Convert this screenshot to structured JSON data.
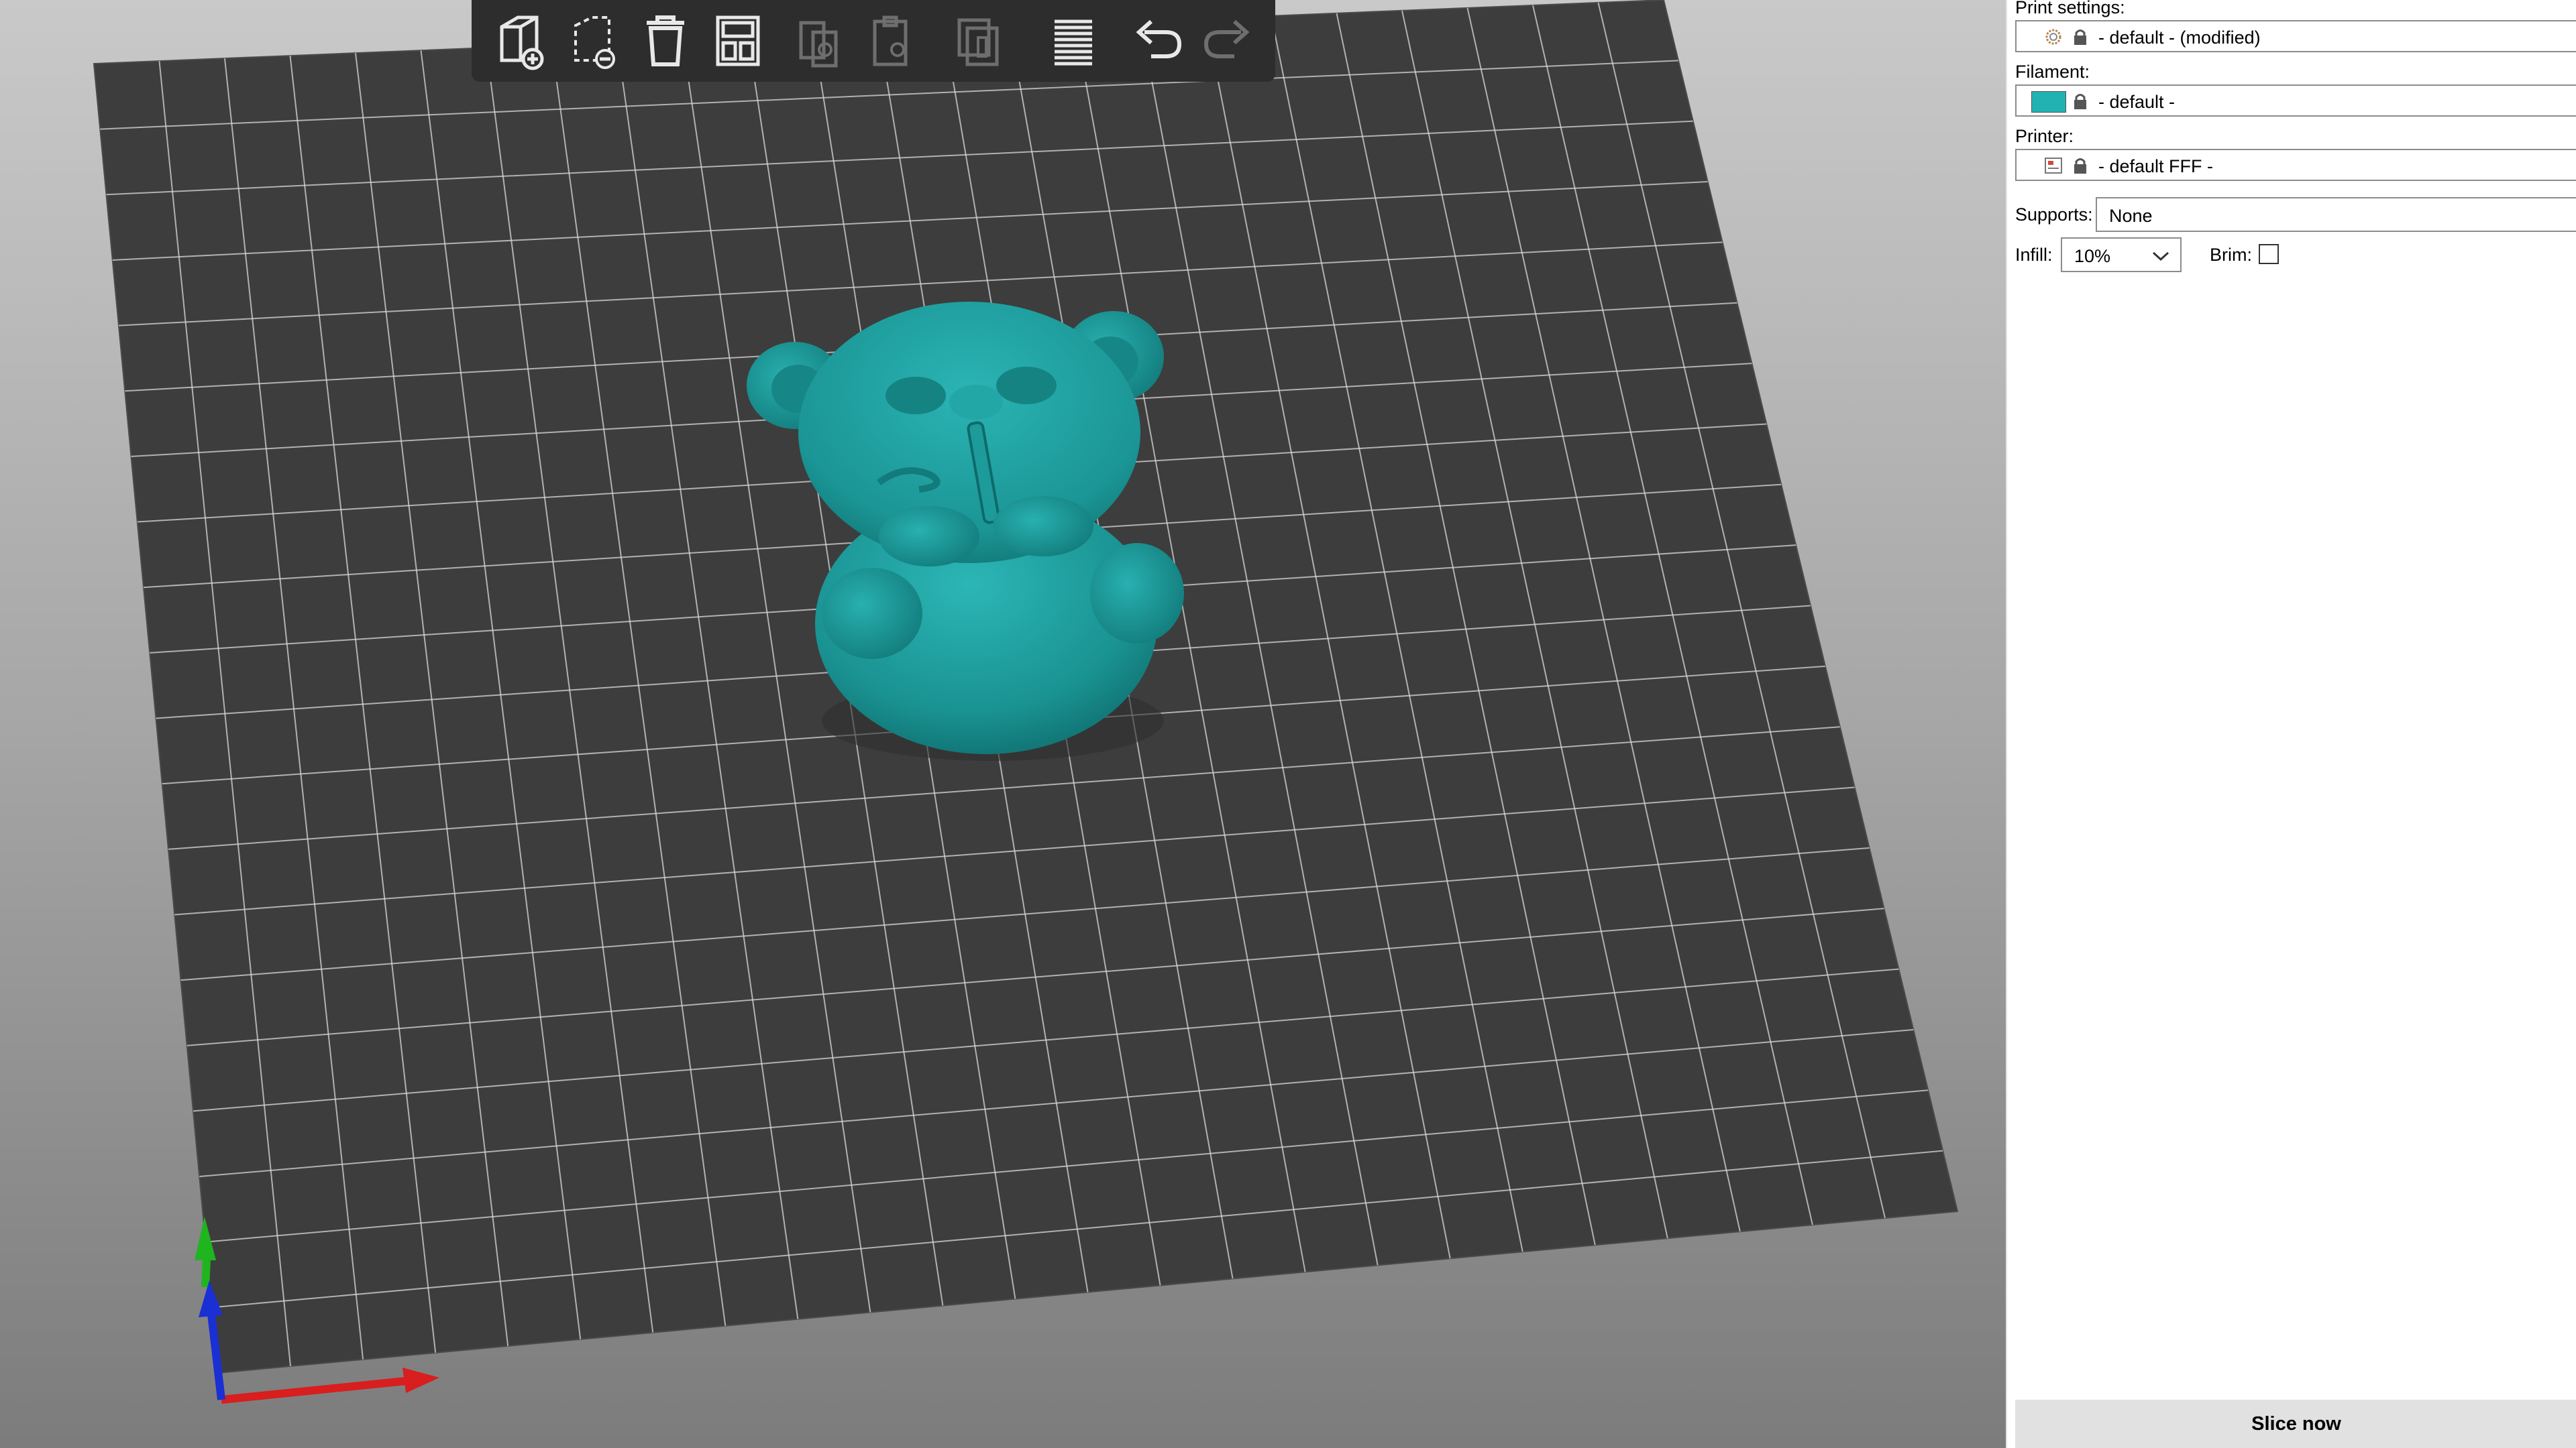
{
  "toolbar": {
    "buttons": [
      {
        "icon": "add-object-icon",
        "enabled": true
      },
      {
        "icon": "delete-selection-icon",
        "enabled": true
      },
      {
        "icon": "delete-all-icon",
        "enabled": true
      },
      {
        "icon": "arrange-icon",
        "enabled": true
      },
      {
        "icon": "copy-icon",
        "enabled": false
      },
      {
        "icon": "paste-icon",
        "enabled": false
      },
      {
        "icon": "add-instance-icon",
        "enabled": false
      },
      {
        "icon": "layers-icon",
        "enabled": true
      },
      {
        "icon": "undo-icon",
        "enabled": true
      },
      {
        "icon": "redo-icon",
        "enabled": false
      }
    ]
  },
  "scene": {
    "model_color": "#1f9e9e",
    "bed_color": "#3d3d3d",
    "grid_color": "#d8d8d8",
    "axes": {
      "x": "#d81e1e",
      "y": "#1fb51f",
      "z": "#1a2fd4"
    }
  },
  "sidebar": {
    "print_settings": {
      "label": "Print settings:",
      "value": "- default - (modified)"
    },
    "filament": {
      "label": "Filament:",
      "value": "- default -",
      "color": "#22b2b2"
    },
    "printer": {
      "label": "Printer:",
      "value": "- default FFF -"
    },
    "supports": {
      "label": "Supports:",
      "value": "None"
    },
    "infill": {
      "label": "Infill:",
      "value": "10%"
    },
    "brim": {
      "label": "Brim:",
      "checked": false
    },
    "slice_button": "Slice now"
  }
}
